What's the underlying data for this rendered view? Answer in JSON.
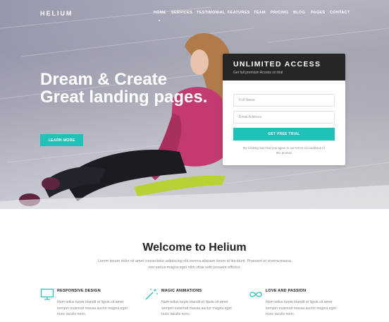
{
  "brand": {
    "logo": "HELIUM",
    "accent": "#1fc1b9",
    "dark": "#262626"
  },
  "nav": {
    "items": [
      "HOME",
      "SERVICES",
      "TESTIMONIAL",
      "FEATURES",
      "TEAM",
      "PRICING",
      "BLOG",
      "PAGES",
      "CONTACT"
    ],
    "active": "HOME"
  },
  "hero": {
    "headline": "Dream & Create Great landing pages.",
    "cta_label": "LEARN MORE"
  },
  "signup": {
    "title": "UNLIMITED ACCESS",
    "subtitle": "Get full premium Access on trial",
    "name_placeholder": "Full Name",
    "email_placeholder": "Email Address",
    "button_label": "GET FREE TRIAL",
    "terms": "By Clicking Get Trial you agree to our terms of conditions of this product"
  },
  "welcome": {
    "title": "Welcome to Helium",
    "text": "Lorem ipsum dolor sit amet consectetur adipiscing elit viverra aliquam lorem id tincidunt. Praesent et viverra massa non varius magna eget nibh vitae velit posuere efficitur."
  },
  "features": [
    {
      "icon": "monitor-icon",
      "title": "RESPONSIVE DESIGN",
      "text": "Nam tellus turpis blandit et ligula sit amet semper euismod massa auctor magna eget nunc iaculis nunc."
    },
    {
      "icon": "magic-wand-icon",
      "title": "MAGIC ANIMATIONS",
      "text": "Nam tellus turpis blandit et ligula sit amet semper euismod massa auctor magna eget nunc iaculis nunc."
    },
    {
      "icon": "infinity-icon",
      "title": "LOVE AND PASSION",
      "text": "Nam tellus turpis blandit et ligula sit amet semper euismod massa auctor magna eget nunc iaculis nunc."
    }
  ]
}
